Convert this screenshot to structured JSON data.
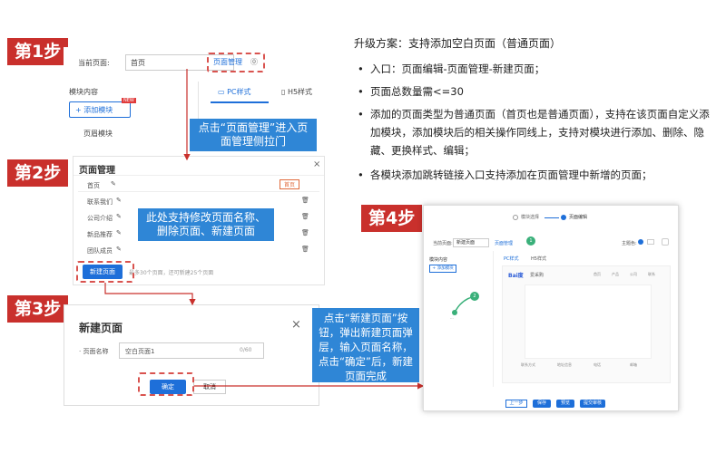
{
  "steps": {
    "s1": "第1步",
    "s2": "第2步",
    "s3": "第3步",
    "s4": "第4步"
  },
  "step1": {
    "current_page_label": "当前页面:",
    "current_page_value": "首页",
    "page_manage": "页面管理",
    "module_content": "模块内容",
    "pc_tab": "PC样式",
    "h5_tab": "H5样式",
    "add_module": "+ 添加模块",
    "new_badge": "NEW",
    "footer_module": "页眉模块",
    "callout": "点击“页面管理”进入页面管理侧拉门"
  },
  "step2": {
    "title": "页面管理",
    "close": "×",
    "rows": [
      "首页",
      "联系我们",
      "公司介绍",
      "新品推荐",
      "团队成员"
    ],
    "home_tag": "首页",
    "new_page_btn": "新建页面",
    "hint": "最多30个页面，还可新建25个页面",
    "callout": "此处支持修改页面名称、删除页面、新建页面"
  },
  "step3": {
    "title": "新建页面",
    "close": "×",
    "name_label": "· 页面名称",
    "name_value": "空白页面1",
    "counter": "0/60",
    "confirm": "确定",
    "cancel": "取消",
    "callout": "点击“新建页面”按钮，弹出新建页面弹层，输入页面名称，点击“确定”后，新建页面完成"
  },
  "step4": {
    "wizard_1": "模块选择",
    "wizard_2": "页面编辑",
    "current_page_label": "当前页面:",
    "current_page_value": "新建页面",
    "page_manage": "页面管理",
    "theme_label": "主题色:",
    "module_content": "模块内容",
    "add_module": "+ 添加模块",
    "pc_tab": "PC样式",
    "h5_tab": "H5样式",
    "baidu": "Bai度",
    "site_name": "爱采购",
    "nav": [
      "首页",
      "产品",
      "公司",
      "联系"
    ],
    "footer_items": [
      "联系方式",
      "地址信息",
      "电话",
      "邮箱"
    ],
    "btn_prev": "上一步",
    "btn_save": "保存",
    "btn_preview": "预览",
    "btn_submit": "提交审核"
  },
  "spec": {
    "heading": "升级方案：支持添加空白页面（普通页面）",
    "bullets": [
      "入口：页面编辑-页面管理-新建页面；",
      "页面总数量需<=30",
      "添加的页面类型为普通页面（首页也是普通页面），支持在该页面自定义添加模块，添加模块后的相关操作同线上，支持对模块进行添加、删除、隐藏、更换样式、编辑；",
      "各模块添加跳转链接入口支持添加在页面管理中新增的页面；"
    ]
  },
  "colors": {
    "accent_red": "#c9302c",
    "blue": "#2f86d6",
    "btn_blue": "#1e6fd9"
  }
}
